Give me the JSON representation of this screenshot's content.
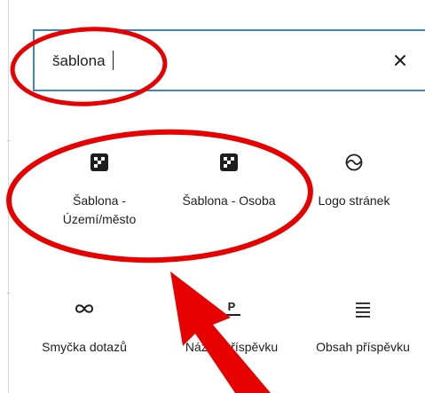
{
  "search": {
    "value": "šablona",
    "clear_icon": "close-icon"
  },
  "blocks": [
    {
      "label_line1": "Šablona -",
      "label_line2": "Území/město",
      "icon": "block-pattern-icon"
    },
    {
      "label_line1": "Šablona - Osoba",
      "icon": "block-pattern-icon"
    },
    {
      "label_line1": "Logo stránek",
      "icon": "site-logo-icon"
    },
    {
      "label_line1": "Smyčka dotazů",
      "icon": "loop-icon"
    },
    {
      "label_line1": "Název příspěvku",
      "icon": "post-title-icon"
    },
    {
      "label_line1": "Obsah příspěvku",
      "icon": "post-content-icon"
    }
  ],
  "annotation": {
    "color": "#e60000"
  }
}
